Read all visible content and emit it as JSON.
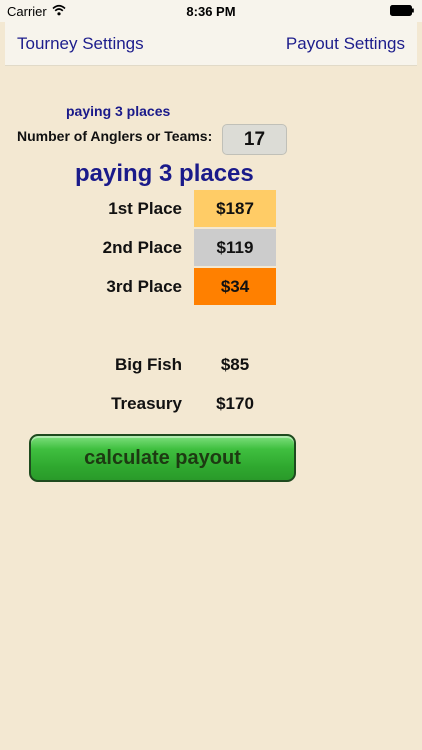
{
  "status_bar": {
    "carrier": "Carrier",
    "time": "8:36 PM"
  },
  "nav": {
    "left_label": "Tourney Settings",
    "right_label": "Payout Settings"
  },
  "header": {
    "paying_small": "paying 3 places"
  },
  "anglers": {
    "label": "Number of Anglers or Teams:",
    "value": "17"
  },
  "summary": {
    "paying_large": "paying 3 places"
  },
  "places": [
    {
      "label": "1st Place",
      "amount": "$187",
      "color": "#ffcc66"
    },
    {
      "label": "2nd Place",
      "amount": "$119",
      "color": "#cccccc"
    },
    {
      "label": "3rd Place",
      "amount": "$34",
      "color": "#ff8000"
    }
  ],
  "extras": {
    "big_fish_label": "Big Fish",
    "big_fish_value": "$85",
    "treasury_label": "Treasury",
    "treasury_value": "$170"
  },
  "actions": {
    "calculate_label": "calculate payout"
  }
}
